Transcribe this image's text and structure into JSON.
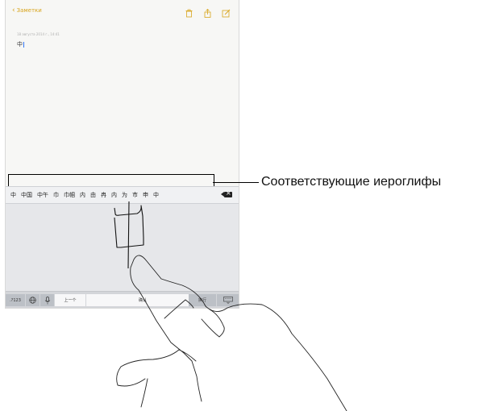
{
  "nav": {
    "back_label": "Заметки",
    "accent_color": "#d8a41b",
    "icons": [
      "trash-icon",
      "share-icon",
      "compose-icon"
    ]
  },
  "note": {
    "date": "18 августа 2014 г., 14:41",
    "text": "中"
  },
  "candidates": [
    "中",
    "中国",
    "中午",
    "巾",
    "巾帼",
    "内",
    "由",
    "冉",
    "内",
    "为",
    "市",
    "申",
    "中"
  ],
  "keyboard": {
    "numbers_key": ".?123",
    "globe_icon": "globe-icon",
    "mic_icon": "microphone-icon",
    "prev_key": "上一个",
    "confirm_key": "确认",
    "return_key": "换行",
    "hide_keyboard_icon": "keyboard-hide-icon"
  },
  "callout": {
    "label": "Соответствующие иероглифы"
  }
}
